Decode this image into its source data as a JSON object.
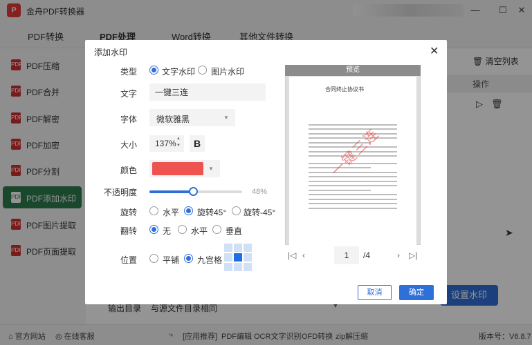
{
  "app": {
    "title": "金舟PDF转换器",
    "logo": "P"
  },
  "window": {
    "minimize": "—",
    "maximize": "☐",
    "close": "✕"
  },
  "nav": {
    "tabs": [
      "PDF转换",
      "PDF处理",
      "Word转换",
      "其他文件转换"
    ],
    "active": 1
  },
  "sidebar": {
    "items": [
      {
        "label": "PDF压缩"
      },
      {
        "label": "PDF合并"
      },
      {
        "label": "PDF解密"
      },
      {
        "label": "PDF加密"
      },
      {
        "label": "PDF分割"
      },
      {
        "label": "PDF添加水印"
      },
      {
        "label": "PDF图片提取"
      },
      {
        "label": "PDF页面提取"
      }
    ],
    "active": 5
  },
  "main": {
    "clear_list": "清空列表",
    "col_op": "操作",
    "set_watermark_button": "设置水印",
    "output_dir_label": "输出目录",
    "output_dir_value": "与源文件目录相同"
  },
  "statusbar": {
    "website": "官方网站",
    "support": "在线客服",
    "recommend": "[应用推荐]",
    "links": [
      "PDF编辑",
      "OCR文字识别",
      "OFD转换",
      "zip解压缩"
    ],
    "version": "版本号：V6.8.7"
  },
  "dialog": {
    "title": "添加水印",
    "close": "✕",
    "type_label": "类型",
    "type_options": [
      "文字水印",
      "图片水印"
    ],
    "type_selected": 0,
    "text_label": "文字",
    "text_value": "一键三连",
    "font_label": "字体",
    "font_value": "微软雅黑",
    "size_label": "大小",
    "size_value": "137%",
    "bold": "B",
    "color_label": "颜色",
    "color_value": "#ef5350",
    "opacity_label": "不透明度",
    "opacity_value": "48%",
    "opacity_fraction": 0.48,
    "rotate_label": "旋转",
    "rotate_options": [
      "水平",
      "旋转45°",
      "旋转-45°"
    ],
    "rotate_selected": 1,
    "flip_label": "翻转",
    "flip_options": [
      "无",
      "水平",
      "垂直"
    ],
    "flip_selected": 0,
    "position_label": "位置",
    "position_options": [
      "平铺",
      "九宫格"
    ],
    "position_selected": 1,
    "grid_selected": [
      1,
      1
    ],
    "preview": {
      "header": "预览",
      "doc_title": "合同终止协议书",
      "watermark": "一键三连",
      "page_current": "1",
      "page_total": "/4"
    },
    "cancel": "取消",
    "ok": "确定"
  }
}
